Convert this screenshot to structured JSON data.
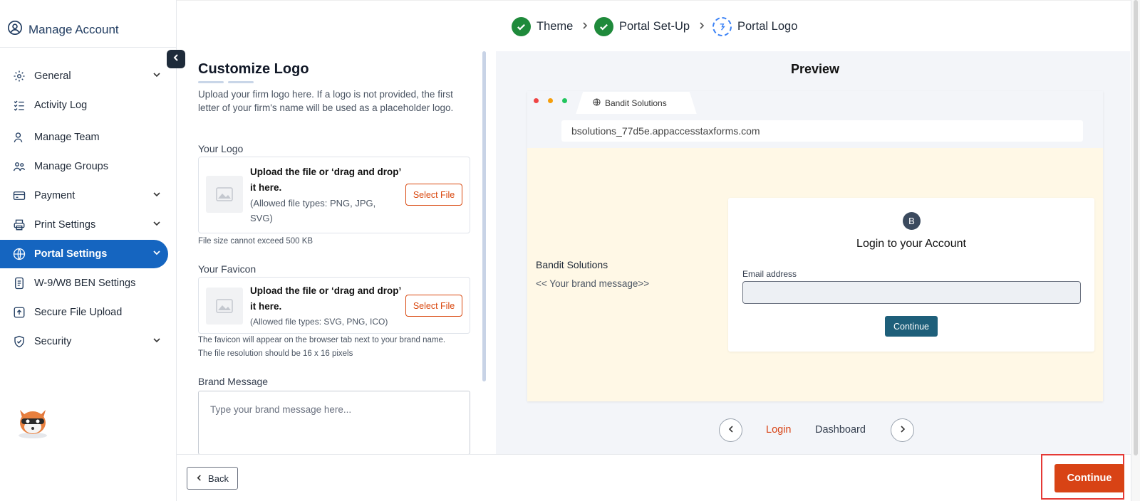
{
  "sidebar": {
    "title": "Manage Account",
    "items": [
      {
        "label": "General",
        "icon": "gear-icon",
        "has_chevron": true
      },
      {
        "label": "Activity Log",
        "icon": "checklist-icon",
        "has_chevron": false
      },
      {
        "label": "Manage Team",
        "icon": "user-icon",
        "has_chevron": false
      },
      {
        "label": "Manage Groups",
        "icon": "group-icon",
        "has_chevron": false
      },
      {
        "label": "Payment",
        "icon": "card-icon",
        "has_chevron": true
      },
      {
        "label": "Print Settings",
        "icon": "printer-icon",
        "has_chevron": true
      },
      {
        "label": "Portal Settings",
        "icon": "globe-icon",
        "has_chevron": true,
        "active": true
      },
      {
        "label": "W-9/W8 BEN Settings",
        "icon": "document-icon",
        "has_chevron": false
      },
      {
        "label": "Secure File Upload",
        "icon": "upload-icon",
        "has_chevron": false
      },
      {
        "label": "Security",
        "icon": "shield-icon",
        "has_chevron": true
      }
    ]
  },
  "stepper": {
    "steps": [
      {
        "label": "Theme",
        "status": "done"
      },
      {
        "label": "Portal Set-Up",
        "status": "done"
      },
      {
        "label": "Portal Logo",
        "status": "current"
      }
    ]
  },
  "form": {
    "title": "Customize Logo",
    "description": "Upload your firm logo here. If a logo is not provided, the first letter of your firm's name will be used as a placeholder logo.",
    "logo": {
      "label": "Your Logo",
      "main_line1": "Upload the file or ‘drag and drop’",
      "main_line2": "it here.",
      "allowed_line1": "(Allowed file types: PNG, JPG,",
      "allowed_line2": "SVG)",
      "button": "Select File",
      "note": "File size cannot exceed 500 KB"
    },
    "favicon": {
      "label": "Your Favicon",
      "main_line1": "Upload the file or ‘drag and drop’",
      "main_line2": "it here.",
      "allowed": "(Allowed file types: SVG, PNG, ICO)",
      "button": "Select File",
      "note_line1": "The favicon will appear on the browser tab next to your brand name.",
      "note_line2": "The file resolution should be 16 x 16 pixels"
    },
    "brand_message": {
      "label": "Brand Message",
      "placeholder": "Type your brand message here..."
    }
  },
  "preview": {
    "title": "Preview",
    "browser_tab": "Bandit Solutions",
    "url": "bsolutions_77d5e.appaccesstaxforms.com",
    "brand_name": "Bandit Solutions",
    "brand_message": "<< Your brand message>>",
    "login": {
      "avatar_letter": "B",
      "title": "Login to your Account",
      "email_label": "Email address",
      "button": "Continue"
    },
    "tabs": [
      "Login",
      "Dashboard"
    ],
    "active_tab": "Login"
  },
  "footer": {
    "back": "Back",
    "continue": "Continue"
  },
  "colors": {
    "primary": "#1565c0",
    "accent": "#d84315",
    "success": "#1f8a3b",
    "preview_bg": "#fff8e6"
  }
}
